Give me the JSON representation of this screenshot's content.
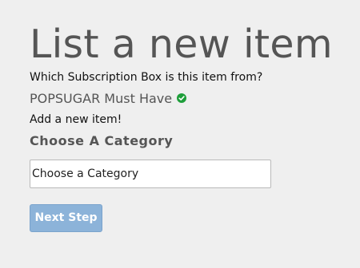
{
  "page": {
    "title": "List a new item"
  },
  "subscription": {
    "question": "Which Subscription Box is this item from?",
    "selected_box": "POPSUGAR Must Have",
    "verified_icon": "check-circle-icon"
  },
  "item": {
    "add_text": "Add a new item!",
    "category_heading": "Choose A Category",
    "category_select_value": "Choose a Category"
  },
  "actions": {
    "next_label": "Next Step"
  },
  "colors": {
    "background": "#efefef",
    "button": "#8cb3d9",
    "check": "#1e9e3a"
  }
}
